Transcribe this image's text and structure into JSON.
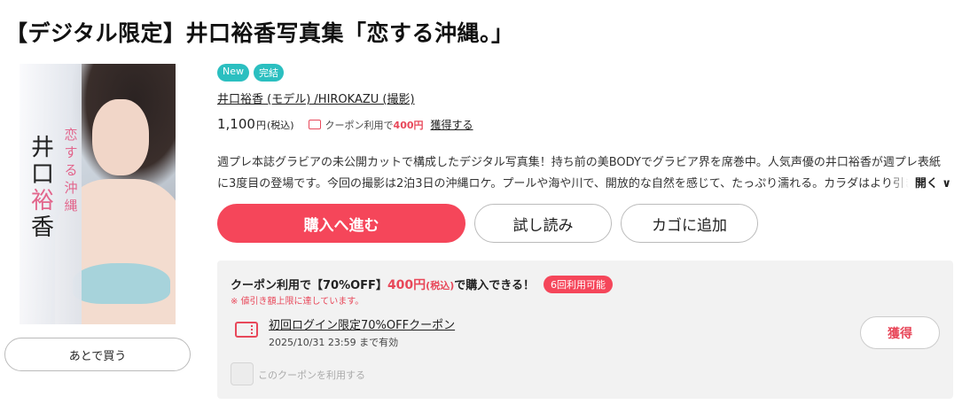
{
  "product": {
    "title": "【デジタル限定】井口裕香写真集「恋する沖縄。」",
    "badges": [
      "New",
      "完結"
    ],
    "authors": "井口裕香 (モデル) /HIROKAZU (撮影)",
    "price": "1,100",
    "price_unit": "円",
    "tax_label": "(税込)",
    "coupon_prefix": "クーポン利用で",
    "coupon_amount": "400円",
    "coupon_get_link": "獲得する",
    "description_line1": "週プレ本誌グラビアの未公開カットで構成したデジタル写真集！持ち前の美BODYでグラビア界を席巻中。人気声優の井口裕香が週プレ表紙",
    "description_line2": "に3度目の登場です。今回の撮影は2泊3日の沖縄ロケ。プールや海や川で、開放的な自然を感じて、たっぷり濡れる。カラダはより引き締",
    "expand_label": "開く ∨"
  },
  "cover": {
    "name_vertical": [
      "井",
      "口",
      "裕",
      "香"
    ],
    "title_vertical": "恋する沖縄"
  },
  "actions": {
    "later": "あとで買う",
    "buy": "購入へ進む",
    "sample": "試し読み",
    "cart": "カゴに追加"
  },
  "coupon": {
    "head_prefix": "クーポン利用で【70%OFF】",
    "head_price": "400円",
    "head_tax": "(税込)",
    "head_suffix": "で購入できる！",
    "uses_badge": "6回利用可能",
    "note": "※ 値引き額上限に達しています。",
    "name": "初回ログイン限定70%OFFクーポン",
    "validity": "2025/10/31 23:59 まで有効",
    "get_button": "獲得",
    "use_checkbox_label": "このクーポンを利用する"
  },
  "colors": {
    "accent": "#f5465a",
    "badge": "#2bbfc0",
    "coupon_bg": "#f2f2f2"
  }
}
